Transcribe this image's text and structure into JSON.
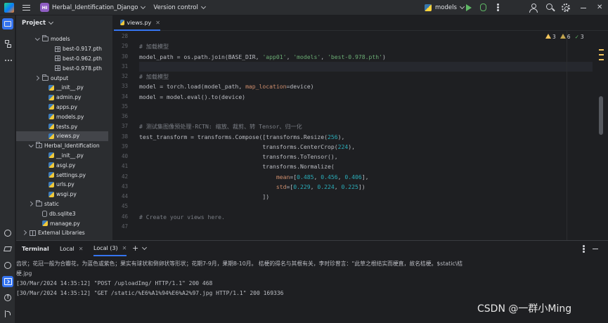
{
  "titlebar": {
    "project_badge": "HI",
    "project_name": "Herbal_Identification_Django",
    "vcs_label": "Version control",
    "run_config": "models"
  },
  "project_panel": {
    "title": "Project",
    "tree": [
      {
        "label": "models",
        "type": "folder",
        "indent": 3,
        "expanded": true
      },
      {
        "label": "best-0.917.pth",
        "type": "file-grid",
        "indent": 5
      },
      {
        "label": "best-0.962.pth",
        "type": "file-grid",
        "indent": 5
      },
      {
        "label": "best-0.978.pth",
        "type": "file-grid",
        "indent": 5
      },
      {
        "label": "output",
        "type": "folder",
        "indent": 3,
        "expanded": false
      },
      {
        "label": "__init__.py",
        "type": "py",
        "indent": 4
      },
      {
        "label": "admin.py",
        "type": "py",
        "indent": 4
      },
      {
        "label": "apps.py",
        "type": "py",
        "indent": 4
      },
      {
        "label": "models.py",
        "type": "py",
        "indent": 4
      },
      {
        "label": "tests.py",
        "type": "py",
        "indent": 4
      },
      {
        "label": "views.py",
        "type": "py",
        "indent": 4,
        "selected": true
      },
      {
        "label": "Herbal_Identification",
        "type": "package",
        "indent": 2,
        "expanded": true
      },
      {
        "label": "__init__.py",
        "type": "py",
        "indent": 4
      },
      {
        "label": "asgi.py",
        "type": "py",
        "indent": 4
      },
      {
        "label": "settings.py",
        "type": "py",
        "indent": 4
      },
      {
        "label": "urls.py",
        "type": "py",
        "indent": 4
      },
      {
        "label": "wsgi.py",
        "type": "py",
        "indent": 4
      },
      {
        "label": "static",
        "type": "folder",
        "indent": 2,
        "expanded": false
      },
      {
        "label": "db.sqlite3",
        "type": "db",
        "indent": 3
      },
      {
        "label": "manage.py",
        "type": "py",
        "indent": 3
      },
      {
        "label": "External Libraries",
        "type": "lib",
        "indent": 1,
        "expanded": false
      }
    ]
  },
  "editor": {
    "tab_label": "views.py",
    "warnings": {
      "warn": "3",
      "weak": "6",
      "ok": "3"
    },
    "lines": [
      {
        "n": "28",
        "segs": []
      },
      {
        "n": "29",
        "segs": [
          {
            "t": "# 加载模型",
            "c": "cm"
          }
        ]
      },
      {
        "n": "30",
        "segs": [
          {
            "t": "model_path = os.path.join(BASE_DIR, ",
            "c": ""
          },
          {
            "t": "'app01'",
            "c": "str"
          },
          {
            "t": ", ",
            "c": ""
          },
          {
            "t": "'models'",
            "c": "str"
          },
          {
            "t": ", ",
            "c": ""
          },
          {
            "t": "'best-0.978.pth'",
            "c": "str"
          },
          {
            "t": ")",
            "c": ""
          }
        ]
      },
      {
        "n": "31",
        "segs": [],
        "current": true
      },
      {
        "n": "32",
        "segs": [
          {
            "t": "# 加载模型",
            "c": "cm"
          }
        ]
      },
      {
        "n": "33",
        "segs": [
          {
            "t": "model = torch.load(model_path, ",
            "c": ""
          },
          {
            "t": "map_location",
            "c": "kw"
          },
          {
            "t": "=device)",
            "c": ""
          }
        ]
      },
      {
        "n": "34",
        "segs": [
          {
            "t": "model = model.eval().to(device)",
            "c": ""
          }
        ]
      },
      {
        "n": "35",
        "segs": []
      },
      {
        "n": "36",
        "segs": []
      },
      {
        "n": "37",
        "segs": [
          {
            "t": "# 测试集图像预处理-RCTN: 缩放、裁剪、转 Tensor、归一化",
            "c": "cm"
          }
        ]
      },
      {
        "n": "38",
        "segs": [
          {
            "t": "test_transform = transforms.Compose([transforms.Resize(",
            "c": ""
          },
          {
            "t": "256",
            "c": "num"
          },
          {
            "t": "),",
            "c": ""
          }
        ]
      },
      {
        "n": "39",
        "segs": [
          {
            "t": "                                    transforms.CenterCrop(",
            "c": ""
          },
          {
            "t": "224",
            "c": "num"
          },
          {
            "t": "),",
            "c": ""
          }
        ]
      },
      {
        "n": "40",
        "segs": [
          {
            "t": "                                    transforms.ToTensor(),",
            "c": ""
          }
        ]
      },
      {
        "n": "41",
        "segs": [
          {
            "t": "                                    transforms.Normalize(",
            "c": ""
          }
        ]
      },
      {
        "n": "42",
        "segs": [
          {
            "t": "                                        ",
            "c": ""
          },
          {
            "t": "mean",
            "c": "kw"
          },
          {
            "t": "=[",
            "c": ""
          },
          {
            "t": "0.485",
            "c": "num"
          },
          {
            "t": ", ",
            "c": ""
          },
          {
            "t": "0.456",
            "c": "num"
          },
          {
            "t": ", ",
            "c": ""
          },
          {
            "t": "0.406",
            "c": "num"
          },
          {
            "t": "],",
            "c": ""
          }
        ]
      },
      {
        "n": "43",
        "segs": [
          {
            "t": "                                        ",
            "c": ""
          },
          {
            "t": "std",
            "c": "kw"
          },
          {
            "t": "=[",
            "c": ""
          },
          {
            "t": "0.229",
            "c": "num"
          },
          {
            "t": ", ",
            "c": ""
          },
          {
            "t": "0.224",
            "c": "num"
          },
          {
            "t": ", ",
            "c": ""
          },
          {
            "t": "0.225",
            "c": "num"
          },
          {
            "t": "])",
            "c": ""
          }
        ]
      },
      {
        "n": "44",
        "segs": [
          {
            "t": "                                    ])",
            "c": ""
          }
        ]
      },
      {
        "n": "45",
        "segs": []
      },
      {
        "n": "46",
        "segs": [
          {
            "t": "# Create your views here.",
            "c": "cm"
          }
        ]
      },
      {
        "n": "47",
        "segs": []
      }
    ]
  },
  "terminal": {
    "title": "Terminal",
    "tabs": [
      "Local",
      "Local (3)"
    ],
    "active_tab": 1,
    "output": [
      "齿状；花冠一般为合瓣花，为蓝色或紫色；果实有球状和倒卵状等形状；花期7-9月，果期8-10月。 桔梗的得名与其根有关，李时珍曾言：“此草之根结实而梗直，故名桔梗。$static\\桔",
      "梗.jpg",
      "[30/Mar/2024 14:35:12] \"POST /uploadImg/ HTTP/1.1\" 200 468",
      "[30/Mar/2024 14:35:12] \"GET /static/%E6%A1%94%E6%A2%97.jpg HTTP/1.1\" 200 169336"
    ],
    "watermark": "CSDN @一群小Ming"
  }
}
